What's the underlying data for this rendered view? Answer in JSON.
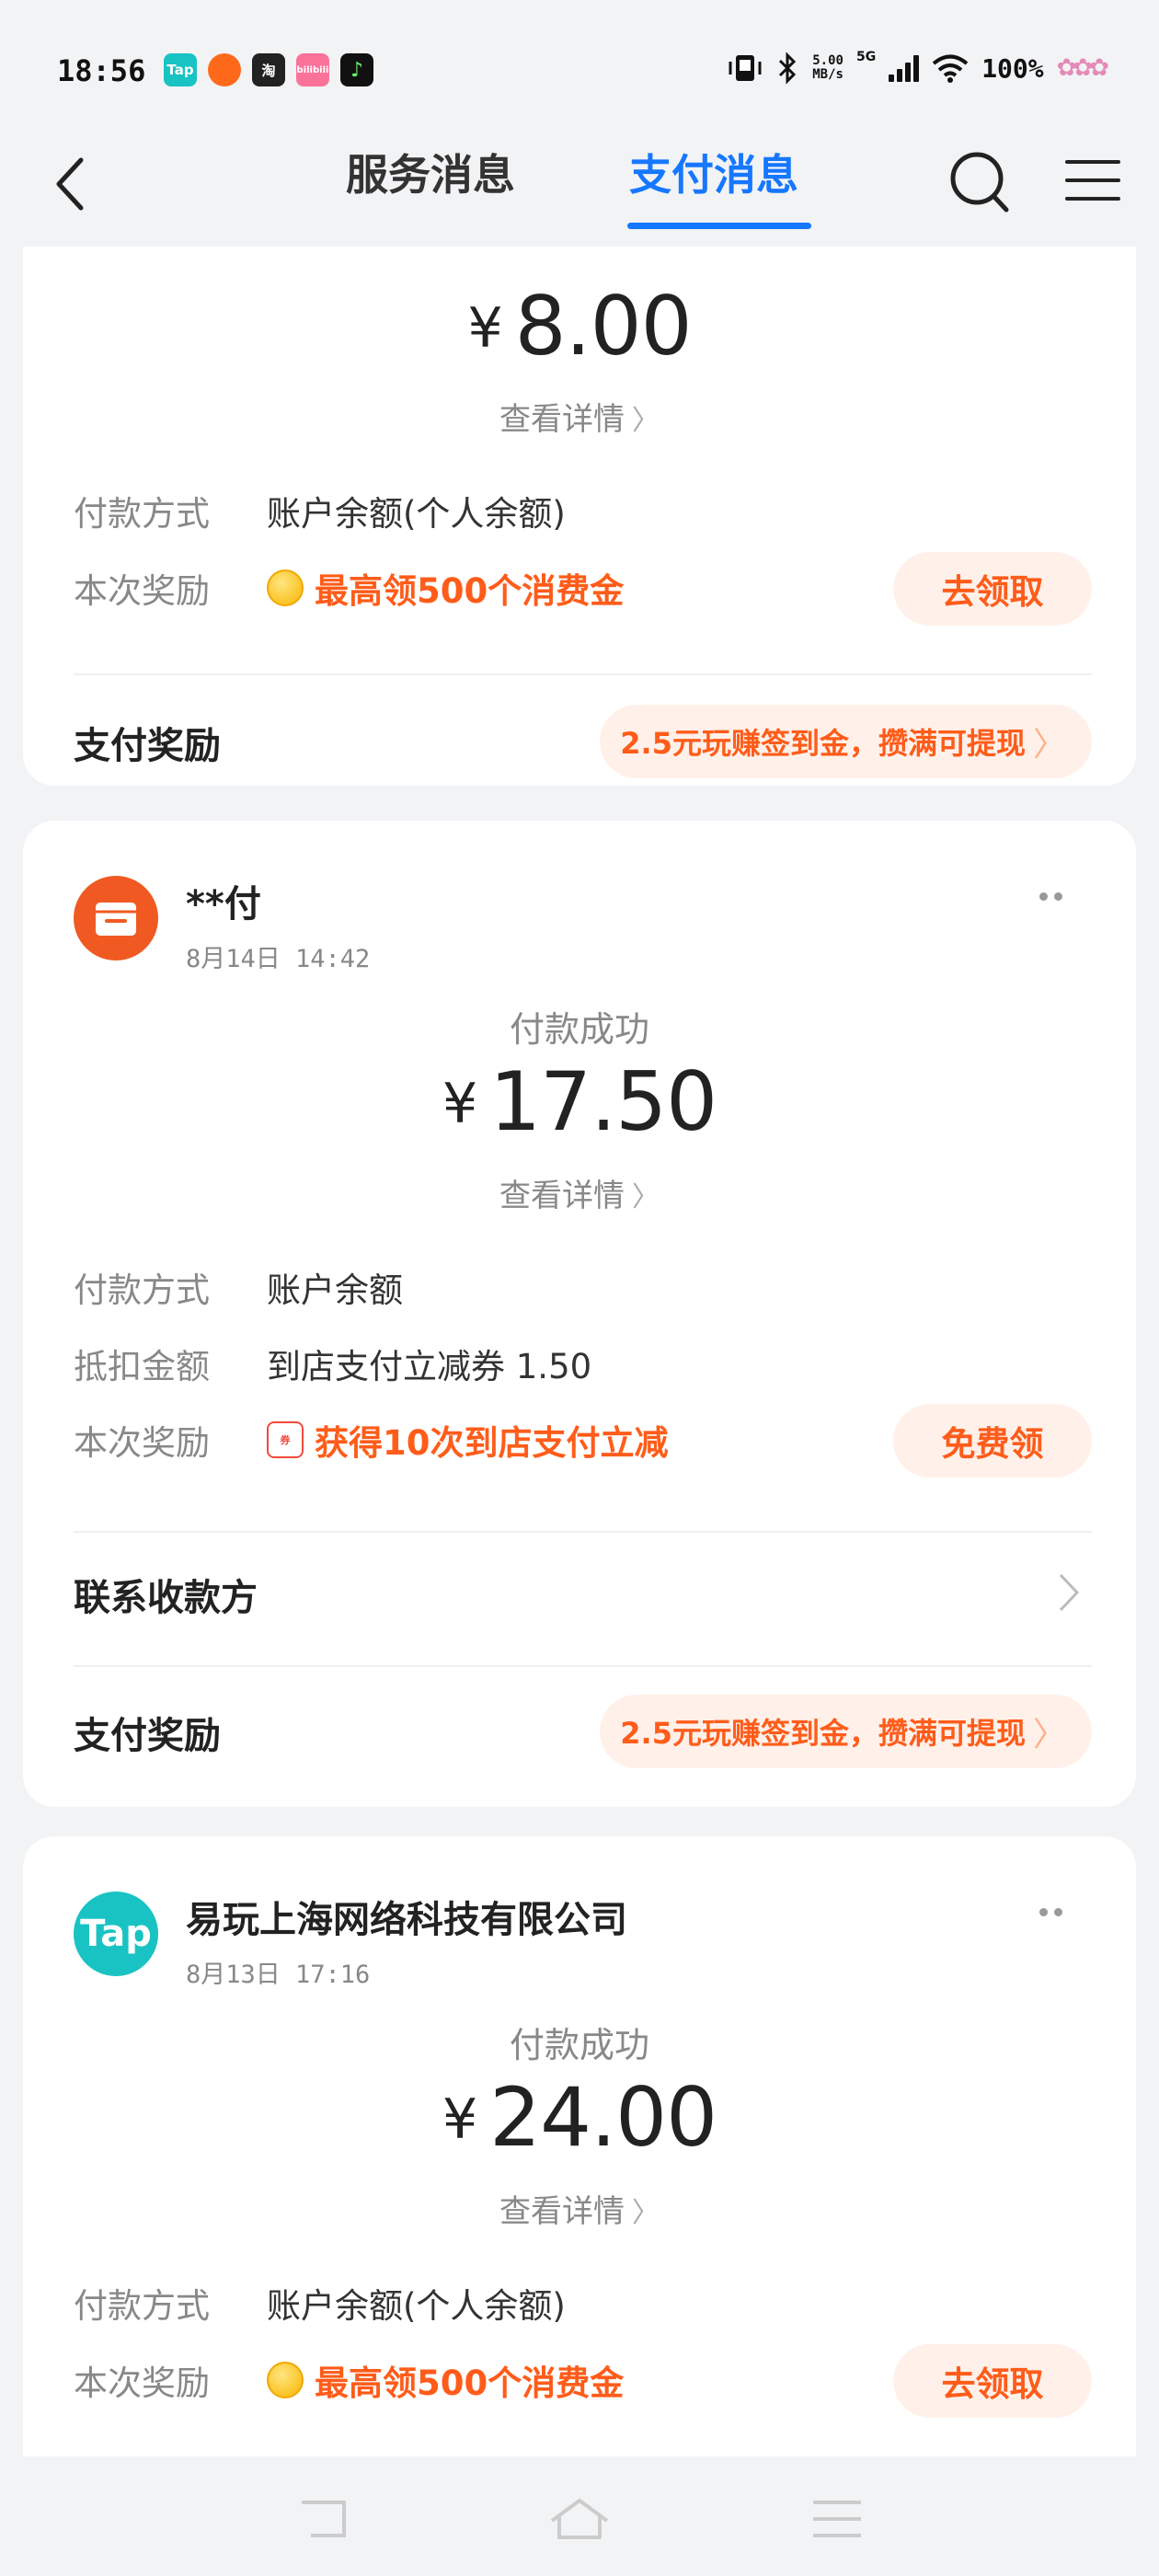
{
  "status_bar": {
    "time": "18:56",
    "app_icons": [
      {
        "label": "Tap",
        "color": "#19c3c3"
      },
      {
        "label": "",
        "color": "#ff6a1a"
      },
      {
        "label": "淘",
        "color": "#222222"
      },
      {
        "label": "bilibili",
        "color": "#fb7299"
      },
      {
        "label": "",
        "color": "#111111"
      }
    ],
    "net_speed_value": "5.00",
    "net_speed_unit": "MB/s",
    "signal_label": "5G",
    "battery": "100%"
  },
  "header": {
    "tabs": [
      {
        "label": "服务消息",
        "active": false
      },
      {
        "label": "支付消息",
        "active": true
      }
    ],
    "accent_color": "#1677ff"
  },
  "cards": [
    {
      "amount_currency": "¥",
      "amount": "8.00",
      "detail_link": "查看详情",
      "payment_method_label": "付款方式",
      "payment_method": "账户余额(个人余额)",
      "reward_label": "本次奖励",
      "reward_text": "最高领500个消费金",
      "reward_button": "去领取",
      "pay_reward_label": "支付奖励",
      "pay_reward_promo": "2.5元玩赚签到金，攒满可提现"
    },
    {
      "merchant": "**付",
      "time": "8月14日  14:42",
      "status": "付款成功",
      "amount_currency": "¥",
      "amount": "17.50",
      "detail_link": "查看详情",
      "payment_method_label": "付款方式",
      "payment_method": "账户余额",
      "deduction_label": "抵扣金额",
      "deduction_value": "到店支付立减券 1.50",
      "reward_label": "本次奖励",
      "reward_text": "获得10次到店支付立减",
      "reward_button": "免费领",
      "contact_label": "联系收款方",
      "pay_reward_label": "支付奖励",
      "pay_reward_promo": "2.5元玩赚签到金，攒满可提现"
    },
    {
      "merchant": "易玩上海网络科技有限公司",
      "logo_text": "Tap",
      "time": "8月13日  17:16",
      "status": "付款成功",
      "amount_currency": "¥",
      "amount": "24.00",
      "detail_link": "查看详情",
      "payment_method_label": "付款方式",
      "payment_method": "账户余额(个人余额)",
      "reward_label": "本次奖励",
      "reward_text": "最高领500个消费金",
      "reward_button": "去领取"
    }
  ],
  "colors": {
    "reward_orange": "#ff5c1a",
    "reward_bg": "#fff1ea",
    "background": "#f2f3f5"
  }
}
